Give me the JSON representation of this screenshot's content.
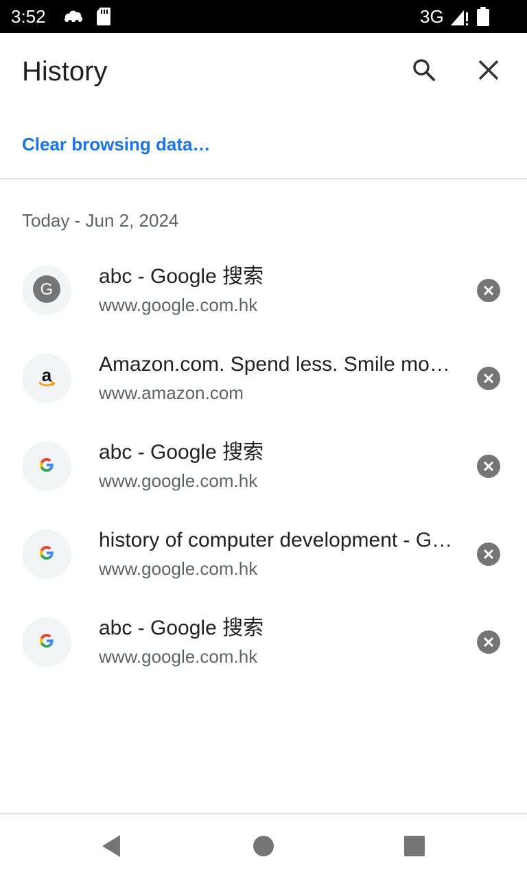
{
  "status_bar": {
    "time": "3:52",
    "network": "3G",
    "left_icons": [
      "cloud-icon",
      "sd-card-icon"
    ],
    "right_icons": [
      "signal-icon",
      "battery-icon"
    ]
  },
  "toolbar": {
    "title": "History",
    "search_icon": "search-icon",
    "close_icon": "close-icon"
  },
  "clear_browsing_data_label": "Clear browsing data…",
  "date_header": "Today - Jun 2, 2024",
  "history_items": [
    {
      "title": "abc - Google 搜索",
      "url": "www.google.com.hk",
      "favicon": "google-g-gray-icon"
    },
    {
      "title": "Amazon.com. Spend less. Smile more.",
      "url": "www.amazon.com",
      "favicon": "amazon-icon"
    },
    {
      "title": "abc - Google 搜索",
      "url": "www.google.com.hk",
      "favicon": "google-icon"
    },
    {
      "title": "history of computer development - Google 搜索",
      "url": "www.google.com.hk",
      "favicon": "google-icon"
    },
    {
      "title": "abc - Google 搜索",
      "url": "www.google.com.hk",
      "favicon": "google-icon"
    }
  ],
  "nav_bar": {
    "back_icon": "back-icon",
    "home_icon": "home-icon",
    "recents_icon": "recents-icon"
  },
  "colors": {
    "accent": "#1a73e8",
    "text_primary": "#202124",
    "text_secondary": "#5f6368",
    "icon_gray": "#757575",
    "status_bar_bg": "#000000"
  }
}
